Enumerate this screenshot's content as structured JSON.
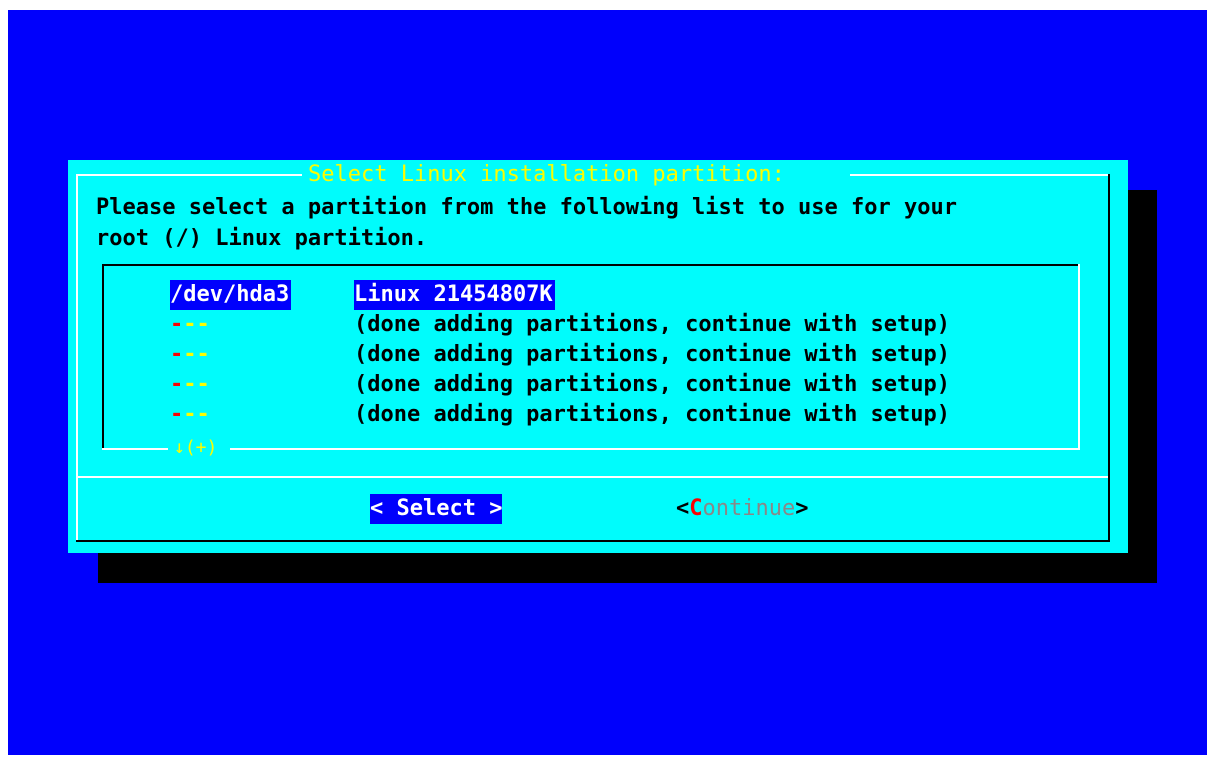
{
  "dialog": {
    "title": "Select Linux installation partition:",
    "prompt_line1": "Please select a partition from the following list to use for your",
    "prompt_line2": "root (/) Linux partition."
  },
  "list": {
    "items": [
      {
        "tag": "/dev/hda3",
        "item": "Linux 21454807K",
        "selected": true
      },
      {
        "tag_hotkey": "-",
        "tag_rest": "--",
        "item": "(done adding partitions, continue with setup)"
      },
      {
        "tag_hotkey": "-",
        "tag_rest": "--",
        "item": "(done adding partitions, continue with setup)"
      },
      {
        "tag_hotkey": "-",
        "tag_rest": "--",
        "item": "(done adding partitions, continue with setup)"
      },
      {
        "tag_hotkey": "-",
        "tag_rest": "--",
        "item": "(done adding partitions, continue with setup)"
      }
    ],
    "scroll_indicator": "↓(+)"
  },
  "buttons": {
    "select_label": "< Select >",
    "continue_open": "<",
    "continue_hotkey": "C",
    "continue_rest": "ontinue",
    "continue_close": ">"
  },
  "colors": {
    "background": "#0000fc",
    "dialog": "#00fcfc",
    "title": "#fcfc00",
    "highlight": "#0000fc",
    "hotkey": "#fc0000"
  }
}
